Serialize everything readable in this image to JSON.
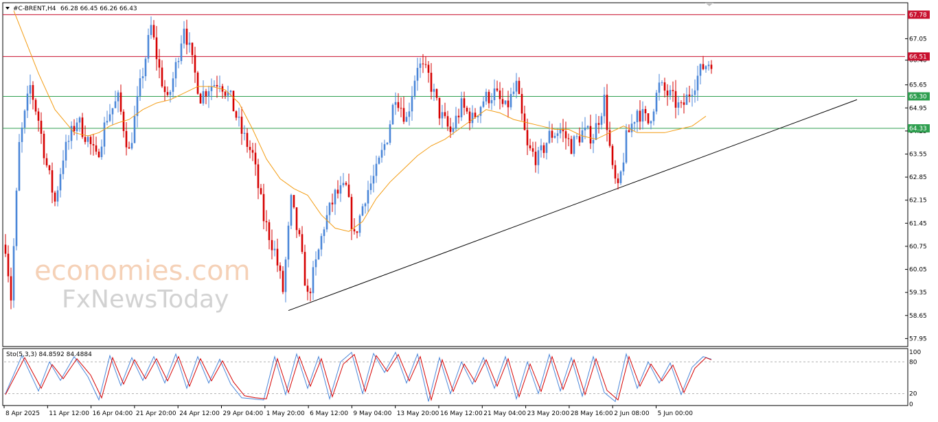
{
  "header": {
    "symbol": "#C-BRENT,H4",
    "ohlc": "66.28 66.45 66.26 66.43",
    "menu_icon": "triangle-down-icon"
  },
  "watermark": {
    "line1": "economies.com",
    "line2": "FxNewsToday"
  },
  "colors": {
    "bull": "#4a86d8",
    "bear": "#d60000",
    "ma": "#f39c12",
    "red_level": "#c8102e",
    "green_level": "#2e9e4f",
    "trend": "#000000",
    "stoch_main": "#4a86d8",
    "stoch_signal": "#d60000"
  },
  "chart_data": [
    {
      "type": "candlestick",
      "symbol": "#C-BRENT",
      "timeframe": "H4",
      "ylim": [
        57.75,
        68.1
      ],
      "yticks": [
        "67.05",
        "66.40",
        "65.65",
        "64.95",
        "64.25",
        "63.55",
        "62.85",
        "62.15",
        "61.45",
        "60.75",
        "60.05",
        "59.35",
        "58.65",
        "57.95"
      ],
      "xticks": [
        "8 Apr 2025",
        "11 Apr 12:00",
        "16 Apr 04:00",
        "21 Apr 20:00",
        "24 Apr 12:00",
        "29 Apr 04:00",
        "1 May 20:00",
        "6 May 12:00",
        "9 May 04:00",
        "13 May 20:00",
        "16 May 12:00",
        "21 May 04:00",
        "23 May 20:00",
        "28 May 16:00",
        "2 Jun 08:00",
        "5 Jun 00:00"
      ],
      "price_anchors": [
        [
          0,
          60.8
        ],
        [
          2,
          59.2
        ],
        [
          5,
          63.8
        ],
        [
          9,
          65.6
        ],
        [
          12,
          64.6
        ],
        [
          15,
          63.2
        ],
        [
          18,
          62.1
        ],
        [
          21,
          63.5
        ],
        [
          26,
          64.6
        ],
        [
          30,
          64.0
        ],
        [
          33,
          63.4
        ],
        [
          37,
          64.7
        ],
        [
          41,
          65.2
        ],
        [
          45,
          63.6
        ],
        [
          49,
          65.6
        ],
        [
          53,
          67.4
        ],
        [
          56,
          66.1
        ],
        [
          59,
          65.1
        ],
        [
          62,
          66.2
        ],
        [
          65,
          67.5
        ],
        [
          68,
          66.3
        ],
        [
          71,
          65.3
        ],
        [
          74,
          65.6
        ],
        [
          78,
          65.8
        ],
        [
          82,
          65.2
        ],
        [
          86,
          64.2
        ],
        [
          90,
          63.5
        ],
        [
          94,
          61.6
        ],
        [
          98,
          60.6
        ],
        [
          101,
          59.4
        ],
        [
          104,
          62.1
        ],
        [
          107,
          60.9
        ],
        [
          110,
          59.2
        ],
        [
          113,
          60.2
        ],
        [
          116,
          61.4
        ],
        [
          120,
          62.3
        ],
        [
          124,
          62.5
        ],
        [
          127,
          61.0
        ],
        [
          131,
          62.3
        ],
        [
          135,
          63.0
        ],
        [
          139,
          64.1
        ],
        [
          142,
          65.4
        ],
        [
          146,
          64.6
        ],
        [
          150,
          66.3
        ],
        [
          154,
          65.9
        ],
        [
          158,
          64.8
        ],
        [
          162,
          64.2
        ],
        [
          166,
          65.0
        ],
        [
          170,
          64.6
        ],
        [
          174,
          65.2
        ],
        [
          178,
          65.4
        ],
        [
          182,
          64.9
        ],
        [
          186,
          65.6
        ],
        [
          190,
          63.7
        ],
        [
          194,
          63.4
        ],
        [
          198,
          64.1
        ],
        [
          202,
          64.3
        ],
        [
          206,
          63.8
        ],
        [
          210,
          64.2
        ],
        [
          214,
          64.1
        ],
        [
          218,
          65.2
        ],
        [
          221,
          63.0
        ],
        [
          223,
          62.4
        ],
        [
          226,
          64.0
        ],
        [
          230,
          64.9
        ],
        [
          234,
          64.5
        ],
        [
          238,
          65.6
        ],
        [
          242,
          65.3
        ],
        [
          246,
          64.9
        ],
        [
          250,
          65.6
        ],
        [
          254,
          66.2
        ],
        [
          257,
          66.4
        ]
      ],
      "moving_average": {
        "x": [
          3,
          12,
          18,
          25,
          30,
          34,
          38,
          41,
          45,
          50,
          55,
          60,
          65,
          70,
          75,
          80,
          85,
          90,
          95,
          100,
          105,
          110,
          115,
          120,
          125,
          130,
          135,
          140,
          145,
          150,
          155,
          160,
          165,
          170,
          175,
          180,
          185,
          190,
          195,
          200,
          205,
          210,
          215,
          220,
          225,
          230,
          235,
          240,
          245,
          250,
          255
        ],
        "y": [
          67.9,
          66.0,
          64.9,
          64.2,
          64.1,
          64.2,
          64.4,
          64.5,
          64.6,
          64.9,
          65.1,
          65.2,
          65.4,
          65.6,
          65.6,
          65.5,
          65.1,
          64.3,
          63.4,
          62.8,
          62.5,
          62.3,
          61.7,
          61.3,
          61.2,
          61.5,
          62.2,
          62.7,
          63.1,
          63.5,
          63.8,
          64.0,
          64.3,
          64.6,
          64.9,
          64.8,
          64.6,
          64.5,
          64.4,
          64.3,
          64.3,
          64.1,
          64.0,
          64.2,
          64.4,
          64.2,
          64.2,
          64.2,
          64.3,
          64.4,
          64.7
        ]
      },
      "levels": [
        {
          "value": 67.78,
          "label": "67.78",
          "color": "#c8102e"
        },
        {
          "value": 66.51,
          "label": "66.51",
          "color": "#c8102e"
        },
        {
          "value": 65.3,
          "label": "65.30",
          "color": "#2e9e4f"
        },
        {
          "value": 64.33,
          "label": "64.33",
          "color": "#2e9e4f"
        }
      ],
      "trendline": {
        "from": [
          103,
          58.8
        ],
        "to": [
          310,
          65.2
        ]
      }
    },
    {
      "type": "line",
      "title": "Sto(5,3,3) 84.8592 84.4884",
      "ylim": [
        0,
        100
      ],
      "yticks": [
        "100",
        "80",
        "20",
        "0"
      ],
      "levels": [
        80,
        20
      ],
      "series": [
        {
          "name": "Sto main",
          "anchors": [
            [
              0,
              20
            ],
            [
              6,
              92
            ],
            [
              12,
              25
            ],
            [
              16,
              80
            ],
            [
              20,
              45
            ],
            [
              25,
              90
            ],
            [
              30,
              52
            ],
            [
              34,
              8
            ],
            [
              38,
              92
            ],
            [
              42,
              35
            ],
            [
              46,
              88
            ],
            [
              50,
              45
            ],
            [
              54,
              90
            ],
            [
              58,
              40
            ],
            [
              62,
              95
            ],
            [
              66,
              30
            ],
            [
              70,
              90
            ],
            [
              74,
              40
            ],
            [
              78,
              85
            ],
            [
              82,
              38
            ],
            [
              86,
              12
            ],
            [
              90,
              10
            ],
            [
              94,
              8
            ],
            [
              98,
              90
            ],
            [
              102,
              18
            ],
            [
              106,
              95
            ],
            [
              110,
              30
            ],
            [
              114,
              90
            ],
            [
              118,
              10
            ],
            [
              122,
              80
            ],
            [
              126,
              98
            ],
            [
              130,
              20
            ],
            [
              134,
              96
            ],
            [
              138,
              60
            ],
            [
              142,
              98
            ],
            [
              146,
              40
            ],
            [
              150,
              95
            ],
            [
              154,
              5
            ],
            [
              158,
              88
            ],
            [
              162,
              20
            ],
            [
              166,
              80
            ],
            [
              170,
              38
            ],
            [
              174,
              88
            ],
            [
              178,
              30
            ],
            [
              182,
              90
            ],
            [
              186,
              10
            ],
            [
              190,
              80
            ],
            [
              194,
              20
            ],
            [
              198,
              94
            ],
            [
              202,
              25
            ],
            [
              206,
              88
            ],
            [
              210,
              15
            ],
            [
              214,
              90
            ],
            [
              218,
              22
            ],
            [
              222,
              5
            ],
            [
              226,
              95
            ],
            [
              230,
              30
            ],
            [
              234,
              80
            ],
            [
              238,
              40
            ],
            [
              242,
              78
            ],
            [
              246,
              18
            ],
            [
              250,
              70
            ],
            [
              254,
              90
            ],
            [
              257,
              85
            ]
          ]
        },
        {
          "name": "Sto signal",
          "anchors": [
            [
              0,
              18
            ],
            [
              7,
              88
            ],
            [
              13,
              30
            ],
            [
              17,
              75
            ],
            [
              21,
              48
            ],
            [
              26,
              86
            ],
            [
              31,
              55
            ],
            [
              35,
              12
            ],
            [
              39,
              88
            ],
            [
              43,
              38
            ],
            [
              47,
              84
            ],
            [
              51,
              48
            ],
            [
              55,
              86
            ],
            [
              59,
              44
            ],
            [
              63,
              90
            ],
            [
              67,
              34
            ],
            [
              71,
              86
            ],
            [
              75,
              44
            ],
            [
              79,
              82
            ],
            [
              83,
              42
            ],
            [
              87,
              16
            ],
            [
              91,
              12
            ],
            [
              95,
              10
            ],
            [
              99,
              86
            ],
            [
              103,
              22
            ],
            [
              107,
              90
            ],
            [
              111,
              34
            ],
            [
              115,
              86
            ],
            [
              119,
              14
            ],
            [
              123,
              76
            ],
            [
              127,
              94
            ],
            [
              131,
              24
            ],
            [
              135,
              92
            ],
            [
              139,
              62
            ],
            [
              143,
              94
            ],
            [
              147,
              44
            ],
            [
              151,
              90
            ],
            [
              155,
              8
            ],
            [
              159,
              84
            ],
            [
              163,
              24
            ],
            [
              167,
              76
            ],
            [
              171,
              42
            ],
            [
              175,
              84
            ],
            [
              179,
              34
            ],
            [
              183,
              86
            ],
            [
              187,
              14
            ],
            [
              191,
              76
            ],
            [
              195,
              24
            ],
            [
              199,
              90
            ],
            [
              203,
              28
            ],
            [
              207,
              84
            ],
            [
              211,
              18
            ],
            [
              215,
              86
            ],
            [
              219,
              26
            ],
            [
              223,
              8
            ],
            [
              227,
              90
            ],
            [
              231,
              34
            ],
            [
              235,
              76
            ],
            [
              239,
              44
            ],
            [
              243,
              74
            ],
            [
              247,
              22
            ],
            [
              251,
              68
            ],
            [
              255,
              88
            ],
            [
              257,
              84
            ]
          ]
        }
      ]
    }
  ]
}
